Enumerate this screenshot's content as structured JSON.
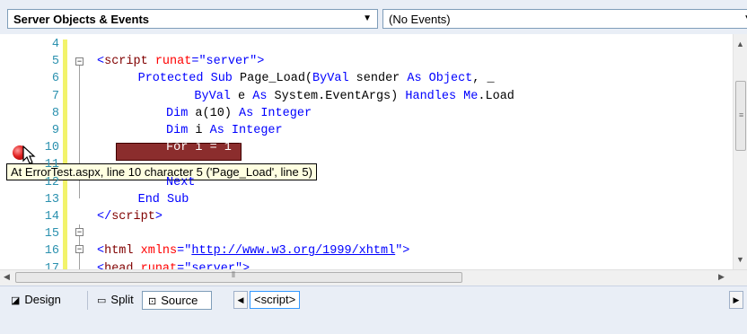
{
  "navbar": {
    "objects_combo": "Server Objects & Events",
    "events_combo": "(No Events)"
  },
  "editor": {
    "lines": [
      {
        "n": "4",
        "tokens": []
      },
      {
        "n": "5",
        "tokens": [
          {
            "t": "<",
            "c": "kw"
          },
          {
            "t": "script",
            "c": "tag"
          },
          {
            "t": " runat",
            "c": "attr"
          },
          {
            "t": "=",
            "c": "kw"
          },
          {
            "t": "\"server\"",
            "c": "kw"
          },
          {
            "t": ">",
            "c": "kw"
          }
        ]
      },
      {
        "n": "6",
        "tokens": [
          {
            "t": "Protected Sub",
            "c": "kw"
          },
          {
            "t": " Page_Load(",
            "c": "plain"
          },
          {
            "t": "ByVal",
            "c": "kw"
          },
          {
            "t": " sender ",
            "c": "plain"
          },
          {
            "t": "As Object",
            "c": "kw"
          },
          {
            "t": ", _",
            "c": "plain"
          }
        ]
      },
      {
        "n": "7",
        "tokens": [
          {
            "t": "    ByVal",
            "c": "kw"
          },
          {
            "t": " e ",
            "c": "plain"
          },
          {
            "t": "As",
            "c": "kw"
          },
          {
            "t": " System.EventArgs) ",
            "c": "plain"
          },
          {
            "t": "Handles Me",
            "c": "kw"
          },
          {
            "t": ".Load",
            "c": "plain"
          }
        ]
      },
      {
        "n": "8",
        "tokens": [
          {
            "t": "  Dim",
            "c": "kw"
          },
          {
            "t": " a(10) ",
            "c": "plain"
          },
          {
            "t": "As Integer",
            "c": "kw"
          }
        ]
      },
      {
        "n": "9",
        "tokens": [
          {
            "t": "  Dim",
            "c": "kw"
          },
          {
            "t": " i ",
            "c": "plain"
          },
          {
            "t": "As Integer",
            "c": "kw"
          }
        ]
      },
      {
        "n": "10",
        "tokens": [
          {
            "t": "  For i = 1 To 11",
            "c": "hltext"
          }
        ]
      },
      {
        "n": "11",
        "tokens": []
      },
      {
        "n": "12",
        "tokens": [
          {
            "t": "  Next",
            "c": "kw"
          }
        ]
      },
      {
        "n": "13",
        "tokens": [
          {
            "t": "End Sub",
            "c": "kw"
          }
        ]
      },
      {
        "n": "14",
        "tokens": [
          {
            "t": "</",
            "c": "kw"
          },
          {
            "t": "script",
            "c": "tag"
          },
          {
            "t": ">",
            "c": "kw"
          }
        ]
      },
      {
        "n": "15",
        "tokens": []
      },
      {
        "n": "16",
        "tokens": [
          {
            "t": "<",
            "c": "kw"
          },
          {
            "t": "html",
            "c": "tag"
          },
          {
            "t": " xmlns",
            "c": "attr"
          },
          {
            "t": "=",
            "c": "kw"
          },
          {
            "t": "\"",
            "c": "kw"
          },
          {
            "t": "http://www.w3.org/1999/xhtml",
            "c": "link"
          },
          {
            "t": "\"",
            "c": "kw"
          },
          {
            "t": ">",
            "c": "kw"
          }
        ]
      },
      {
        "n": "17",
        "tokens": [
          {
            "t": "<",
            "c": "kw"
          },
          {
            "t": "head",
            "c": "tag"
          },
          {
            "t": " runat",
            "c": "attr"
          },
          {
            "t": "=",
            "c": "kw"
          },
          {
            "t": "\"server\"",
            "c": "kw"
          },
          {
            "t": ">",
            "c": "kw"
          }
        ]
      }
    ],
    "tooltip": "At ErrorTest.aspx, line 10 character 5 ('Page_Load', line 5)"
  },
  "bottombar": {
    "design": "Design",
    "split": "Split",
    "source": "Source",
    "tag": "<script>"
  },
  "colors": {
    "keyword": "#0000ff",
    "tag": "#800000",
    "attr": "#ff0000",
    "linenum": "#2b91af",
    "highlight": "#8b2d2d",
    "tooltip_bg": "#ffffe1"
  },
  "icons": [
    "dropdown-arrow-icon",
    "breakpoint-icon",
    "mouse-cursor-icon",
    "design-icon",
    "split-icon",
    "source-icon"
  ]
}
